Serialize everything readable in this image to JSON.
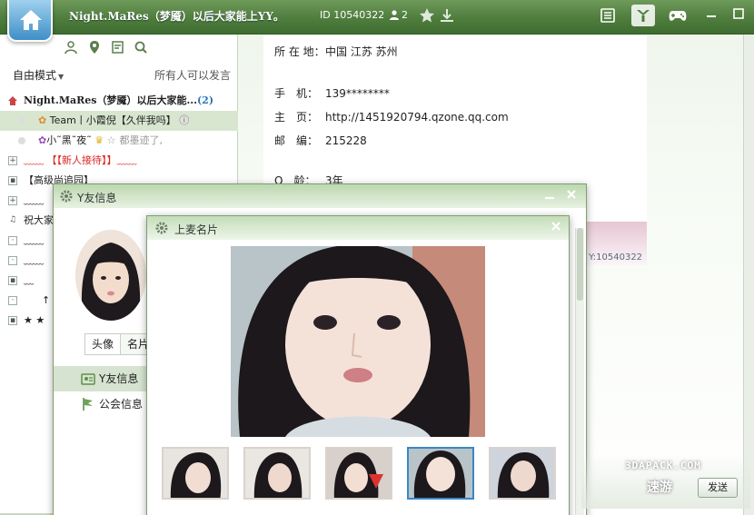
{
  "topbar": {
    "channel_title": "Night.MaRes（梦魇）以后大家能上YY。",
    "channel_id": "ID 10540322",
    "online_count": "2"
  },
  "left": {
    "mode_label": "自由模式",
    "mode_right": "所有人可以发言",
    "tree": [
      {
        "text": "Night.MaRes（梦魇）以后大家能...",
        "count": "(2)"
      },
      {
        "text": "Team丨小霞倪【久伴我吗】"
      },
      {
        "text": "小˜黑˜夜˜",
        "extra": "都墨迹了,"
      },
      {
        "text": "【新人接待】"
      },
      {
        "text": "【高级尚追园】"
      },
      {
        "text": "﹏﹏"
      },
      {
        "text": "祝大家"
      },
      {
        "text": "﹏﹏"
      },
      {
        "text": "﹏﹏"
      },
      {
        "text": "﹏"
      },
      {
        "text": "↑"
      },
      {
        "text": "★ ★"
      }
    ]
  },
  "info": {
    "location_label": "所 在 地：",
    "location_value": "中国 江苏 苏州",
    "phone_label": "手　机：",
    "phone_value": "139********",
    "homepage_label": "主　页：",
    "homepage_value": "http://1451920794.qzone.qq.com",
    "zip_label": "邮　编：",
    "zip_value": "215228",
    "age_label": "Q　龄：",
    "age_value": "3年",
    "tail_text": "Y:10540322"
  },
  "friend_window": {
    "title": "Y友信息",
    "seg": [
      "头像",
      "名片"
    ],
    "nav": [
      "Y友信息",
      "公会信息"
    ]
  },
  "photo_window": {
    "title": "上麦名片"
  },
  "watermark": {
    "brand": "3DAPACK.COM",
    "cn": "速游",
    "send": "发送"
  }
}
